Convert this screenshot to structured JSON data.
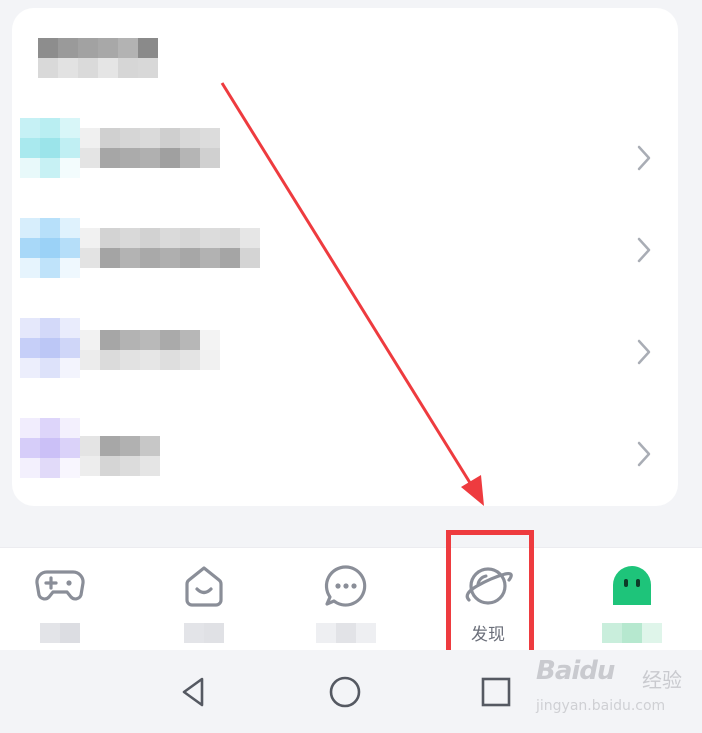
{
  "bottom_nav": {
    "items": [
      {
        "icon": "gamepad-icon"
      },
      {
        "icon": "smiley-icon"
      },
      {
        "icon": "chat-bubble-icon"
      },
      {
        "icon": "planet-icon",
        "label": "发现"
      },
      {
        "icon": "ghost-avatar-icon"
      }
    ]
  },
  "system_nav": {
    "buttons": [
      "back-icon",
      "home-icon",
      "recents-icon"
    ]
  },
  "watermark": {
    "logo": "Baidu",
    "cn": "经验",
    "sub": "jingyan.baidu.com"
  },
  "colors": {
    "highlight": "#ee3b3f",
    "ghost_green": "#1ec47a"
  }
}
